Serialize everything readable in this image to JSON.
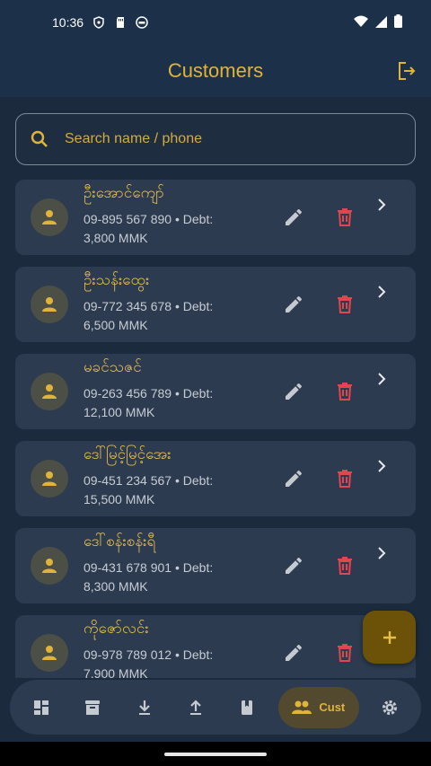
{
  "status": {
    "time": "10:36"
  },
  "appbar": {
    "title": "Customers"
  },
  "search": {
    "placeholder": "Search name / phone"
  },
  "customers": [
    {
      "name": "ဦးအောင်ကျော်",
      "phone": "09-895 567 890",
      "debt_prefix": "Debt:",
      "debt": "3,800 MMK"
    },
    {
      "name": "ဦးသန်းထွေး",
      "phone": "09-772 345 678",
      "debt_prefix": "Debt:",
      "debt": "6,500 MMK"
    },
    {
      "name": "မခင်သဇင်",
      "phone": "09-263 456 789",
      "debt_prefix": "Debt:",
      "debt": "12,100 MMK"
    },
    {
      "name": "ဒေါ်မြင့်မြင့်အေး",
      "phone": "09-451 234 567",
      "debt_prefix": "Debt:",
      "debt": "15,500 MMK"
    },
    {
      "name": "ဒေါ်စန်းစန်းရီ",
      "phone": "09-431 678 901",
      "debt_prefix": "Debt:",
      "debt": "8,300 MMK"
    },
    {
      "name": "ကိုဇော်လင်း",
      "phone": "09-978 789 012",
      "debt_prefix": "Debt:",
      "debt": "7,900 MMK"
    }
  ],
  "nav": {
    "items": [
      {
        "icon": "dashboard-icon"
      },
      {
        "icon": "archive-icon"
      },
      {
        "icon": "download-icon"
      },
      {
        "icon": "upload-icon"
      },
      {
        "icon": "book-icon"
      },
      {
        "icon": "people-icon",
        "label": "Cust"
      },
      {
        "icon": "settings-icon"
      }
    ]
  },
  "colors": {
    "accent": "#e0b43a",
    "delete": "#e0464d",
    "background": "#1b2a3d",
    "card": "#2c3b4f"
  }
}
